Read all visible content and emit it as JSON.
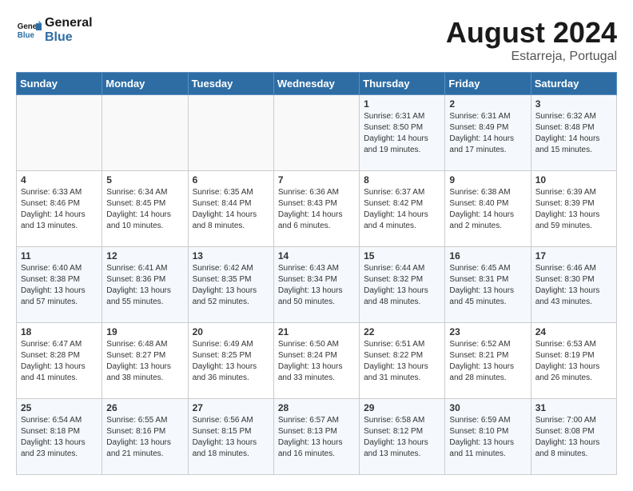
{
  "logo": {
    "line1": "General",
    "line2": "Blue"
  },
  "title": "August 2024",
  "subtitle": "Estarreja, Portugal",
  "weekdays": [
    "Sunday",
    "Monday",
    "Tuesday",
    "Wednesday",
    "Thursday",
    "Friday",
    "Saturday"
  ],
  "weeks": [
    [
      {
        "day": "",
        "info": ""
      },
      {
        "day": "",
        "info": ""
      },
      {
        "day": "",
        "info": ""
      },
      {
        "day": "",
        "info": ""
      },
      {
        "day": "1",
        "info": "Sunrise: 6:31 AM\nSunset: 8:50 PM\nDaylight: 14 hours\nand 19 minutes."
      },
      {
        "day": "2",
        "info": "Sunrise: 6:31 AM\nSunset: 8:49 PM\nDaylight: 14 hours\nand 17 minutes."
      },
      {
        "day": "3",
        "info": "Sunrise: 6:32 AM\nSunset: 8:48 PM\nDaylight: 14 hours\nand 15 minutes."
      }
    ],
    [
      {
        "day": "4",
        "info": "Sunrise: 6:33 AM\nSunset: 8:46 PM\nDaylight: 14 hours\nand 13 minutes."
      },
      {
        "day": "5",
        "info": "Sunrise: 6:34 AM\nSunset: 8:45 PM\nDaylight: 14 hours\nand 10 minutes."
      },
      {
        "day": "6",
        "info": "Sunrise: 6:35 AM\nSunset: 8:44 PM\nDaylight: 14 hours\nand 8 minutes."
      },
      {
        "day": "7",
        "info": "Sunrise: 6:36 AM\nSunset: 8:43 PM\nDaylight: 14 hours\nand 6 minutes."
      },
      {
        "day": "8",
        "info": "Sunrise: 6:37 AM\nSunset: 8:42 PM\nDaylight: 14 hours\nand 4 minutes."
      },
      {
        "day": "9",
        "info": "Sunrise: 6:38 AM\nSunset: 8:40 PM\nDaylight: 14 hours\nand 2 minutes."
      },
      {
        "day": "10",
        "info": "Sunrise: 6:39 AM\nSunset: 8:39 PM\nDaylight: 13 hours\nand 59 minutes."
      }
    ],
    [
      {
        "day": "11",
        "info": "Sunrise: 6:40 AM\nSunset: 8:38 PM\nDaylight: 13 hours\nand 57 minutes."
      },
      {
        "day": "12",
        "info": "Sunrise: 6:41 AM\nSunset: 8:36 PM\nDaylight: 13 hours\nand 55 minutes."
      },
      {
        "day": "13",
        "info": "Sunrise: 6:42 AM\nSunset: 8:35 PM\nDaylight: 13 hours\nand 52 minutes."
      },
      {
        "day": "14",
        "info": "Sunrise: 6:43 AM\nSunset: 8:34 PM\nDaylight: 13 hours\nand 50 minutes."
      },
      {
        "day": "15",
        "info": "Sunrise: 6:44 AM\nSunset: 8:32 PM\nDaylight: 13 hours\nand 48 minutes."
      },
      {
        "day": "16",
        "info": "Sunrise: 6:45 AM\nSunset: 8:31 PM\nDaylight: 13 hours\nand 45 minutes."
      },
      {
        "day": "17",
        "info": "Sunrise: 6:46 AM\nSunset: 8:30 PM\nDaylight: 13 hours\nand 43 minutes."
      }
    ],
    [
      {
        "day": "18",
        "info": "Sunrise: 6:47 AM\nSunset: 8:28 PM\nDaylight: 13 hours\nand 41 minutes."
      },
      {
        "day": "19",
        "info": "Sunrise: 6:48 AM\nSunset: 8:27 PM\nDaylight: 13 hours\nand 38 minutes."
      },
      {
        "day": "20",
        "info": "Sunrise: 6:49 AM\nSunset: 8:25 PM\nDaylight: 13 hours\nand 36 minutes."
      },
      {
        "day": "21",
        "info": "Sunrise: 6:50 AM\nSunset: 8:24 PM\nDaylight: 13 hours\nand 33 minutes."
      },
      {
        "day": "22",
        "info": "Sunrise: 6:51 AM\nSunset: 8:22 PM\nDaylight: 13 hours\nand 31 minutes."
      },
      {
        "day": "23",
        "info": "Sunrise: 6:52 AM\nSunset: 8:21 PM\nDaylight: 13 hours\nand 28 minutes."
      },
      {
        "day": "24",
        "info": "Sunrise: 6:53 AM\nSunset: 8:19 PM\nDaylight: 13 hours\nand 26 minutes."
      }
    ],
    [
      {
        "day": "25",
        "info": "Sunrise: 6:54 AM\nSunset: 8:18 PM\nDaylight: 13 hours\nand 23 minutes."
      },
      {
        "day": "26",
        "info": "Sunrise: 6:55 AM\nSunset: 8:16 PM\nDaylight: 13 hours\nand 21 minutes."
      },
      {
        "day": "27",
        "info": "Sunrise: 6:56 AM\nSunset: 8:15 PM\nDaylight: 13 hours\nand 18 minutes."
      },
      {
        "day": "28",
        "info": "Sunrise: 6:57 AM\nSunset: 8:13 PM\nDaylight: 13 hours\nand 16 minutes."
      },
      {
        "day": "29",
        "info": "Sunrise: 6:58 AM\nSunset: 8:12 PM\nDaylight: 13 hours\nand 13 minutes."
      },
      {
        "day": "30",
        "info": "Sunrise: 6:59 AM\nSunset: 8:10 PM\nDaylight: 13 hours\nand 11 minutes."
      },
      {
        "day": "31",
        "info": "Sunrise: 7:00 AM\nSunset: 8:08 PM\nDaylight: 13 hours\nand 8 minutes."
      }
    ]
  ]
}
